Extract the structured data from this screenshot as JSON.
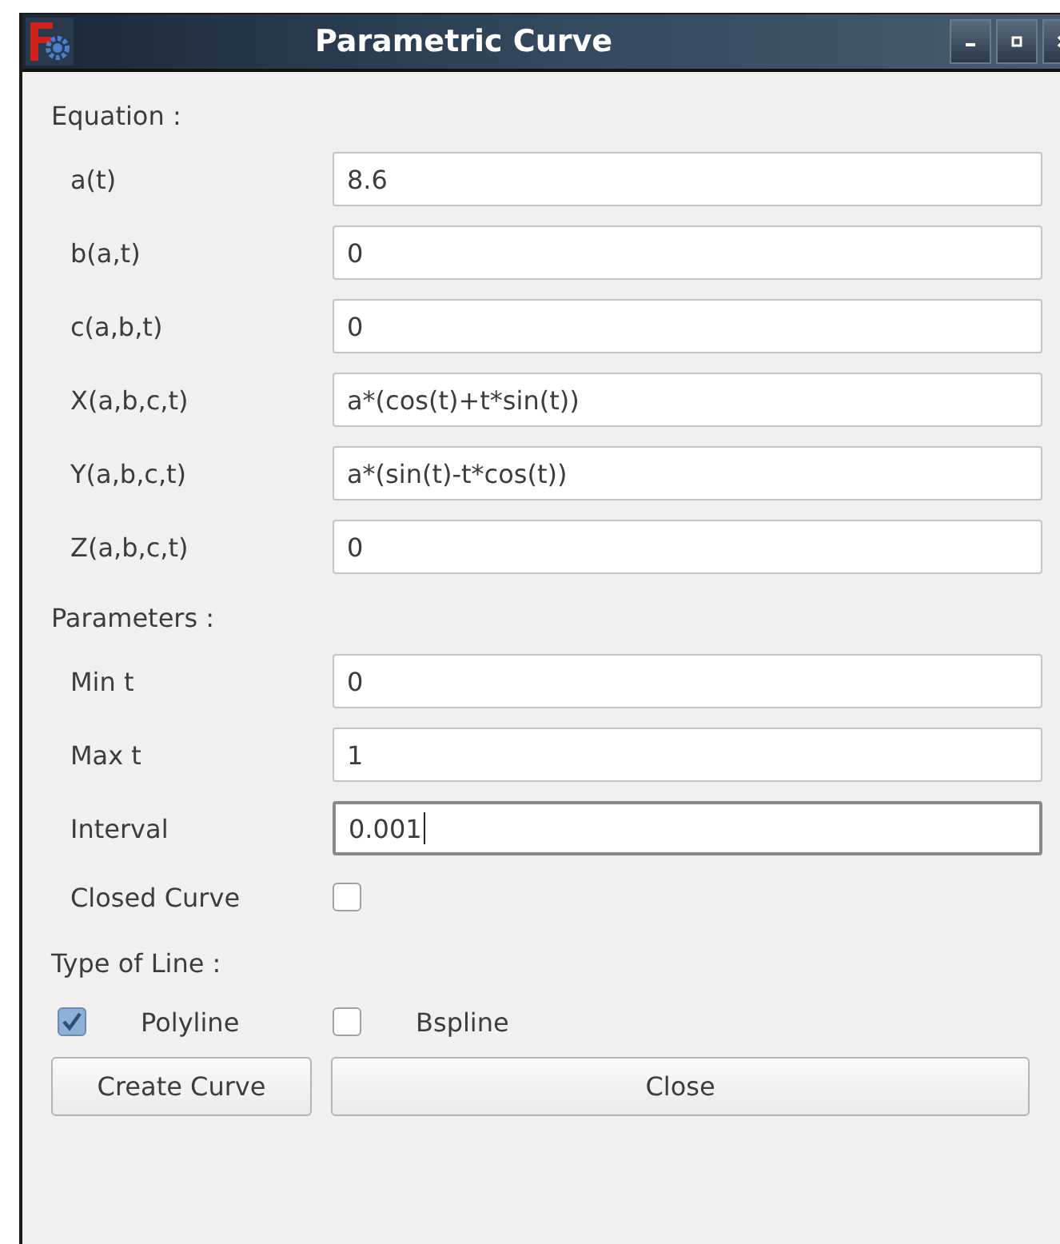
{
  "window": {
    "title": "Parametric Curve"
  },
  "equation": {
    "heading": "Equation :",
    "fields": [
      {
        "label": "a(t)",
        "value": "8.6",
        "focused": false
      },
      {
        "label": "b(a,t)",
        "value": "0",
        "focused": false
      },
      {
        "label": "c(a,b,t)",
        "value": "0",
        "focused": false
      },
      {
        "label": "X(a,b,c,t)",
        "value": "a*(cos(t)+t*sin(t))",
        "focused": false
      },
      {
        "label": "Y(a,b,c,t)",
        "value": "a*(sin(t)-t*cos(t))",
        "focused": false
      },
      {
        "label": "Z(a,b,c,t)",
        "value": "0",
        "focused": false
      }
    ]
  },
  "parameters": {
    "heading": "Parameters :",
    "fields": [
      {
        "label": "Min t",
        "value": "0",
        "focused": false
      },
      {
        "label": "Max t",
        "value": "1",
        "focused": false
      },
      {
        "label": "Interval",
        "value": "0.001",
        "focused": true
      }
    ],
    "closed_curve": {
      "label": "Closed Curve",
      "checked": false
    }
  },
  "line_type": {
    "heading": "Type of Line :",
    "options": [
      {
        "label": "Polyline",
        "checked": true
      },
      {
        "label": "Bspline",
        "checked": false
      }
    ]
  },
  "buttons": [
    "Create Curve",
    "Close"
  ]
}
